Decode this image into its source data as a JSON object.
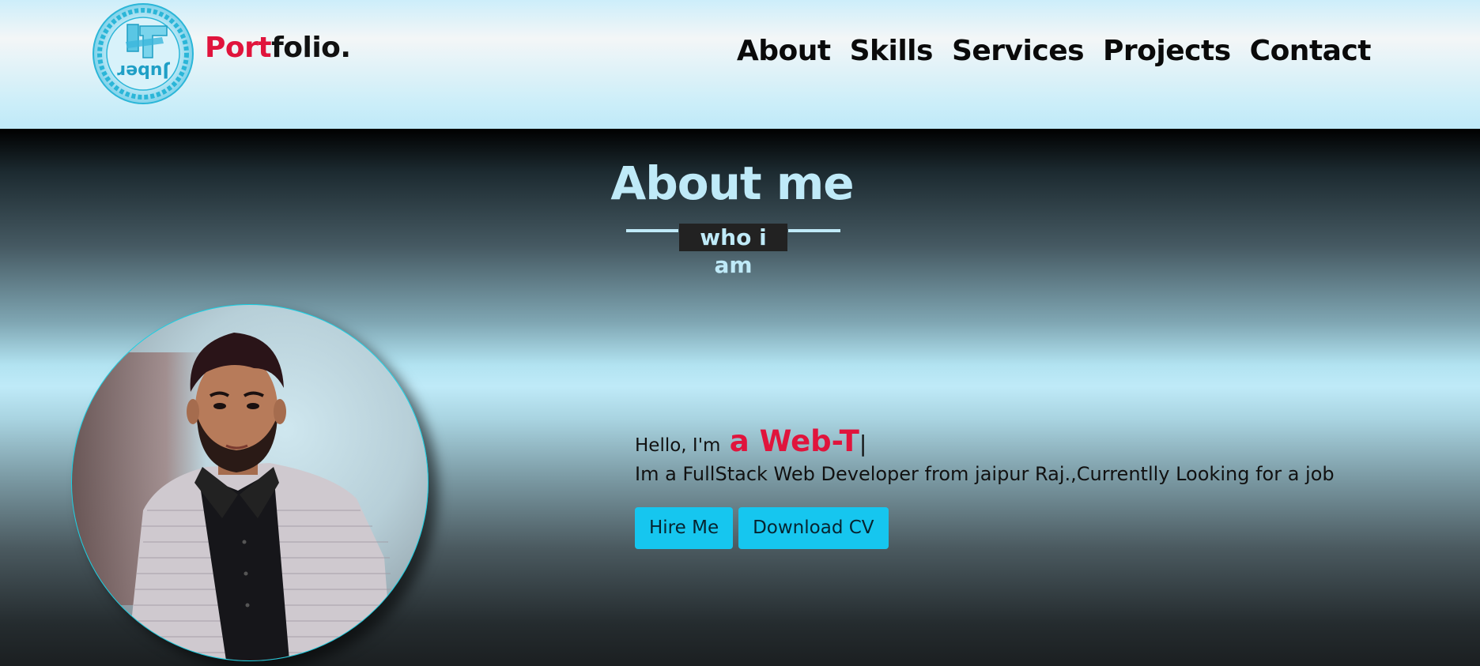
{
  "header": {
    "logo_text": "Juber",
    "brand_accent": "Port",
    "brand_rest": "folio.",
    "nav": [
      "About",
      "Skills",
      "Services",
      "Projects",
      "Contact"
    ]
  },
  "hero": {
    "title": "About me",
    "subtitle": "who i am",
    "hello_prefix": "Hello, I'm",
    "role_text": "a Web-T",
    "cursor": "|",
    "description": "Im a FullStack Web Developer from jaipur Raj.,Currentlly Looking for a job",
    "hire_label": "Hire Me",
    "cv_label": "Download CV"
  },
  "colors": {
    "accent_red": "#e0143c",
    "accent_cyan": "#16c6ef",
    "light_blue": "#bfeaf8"
  }
}
